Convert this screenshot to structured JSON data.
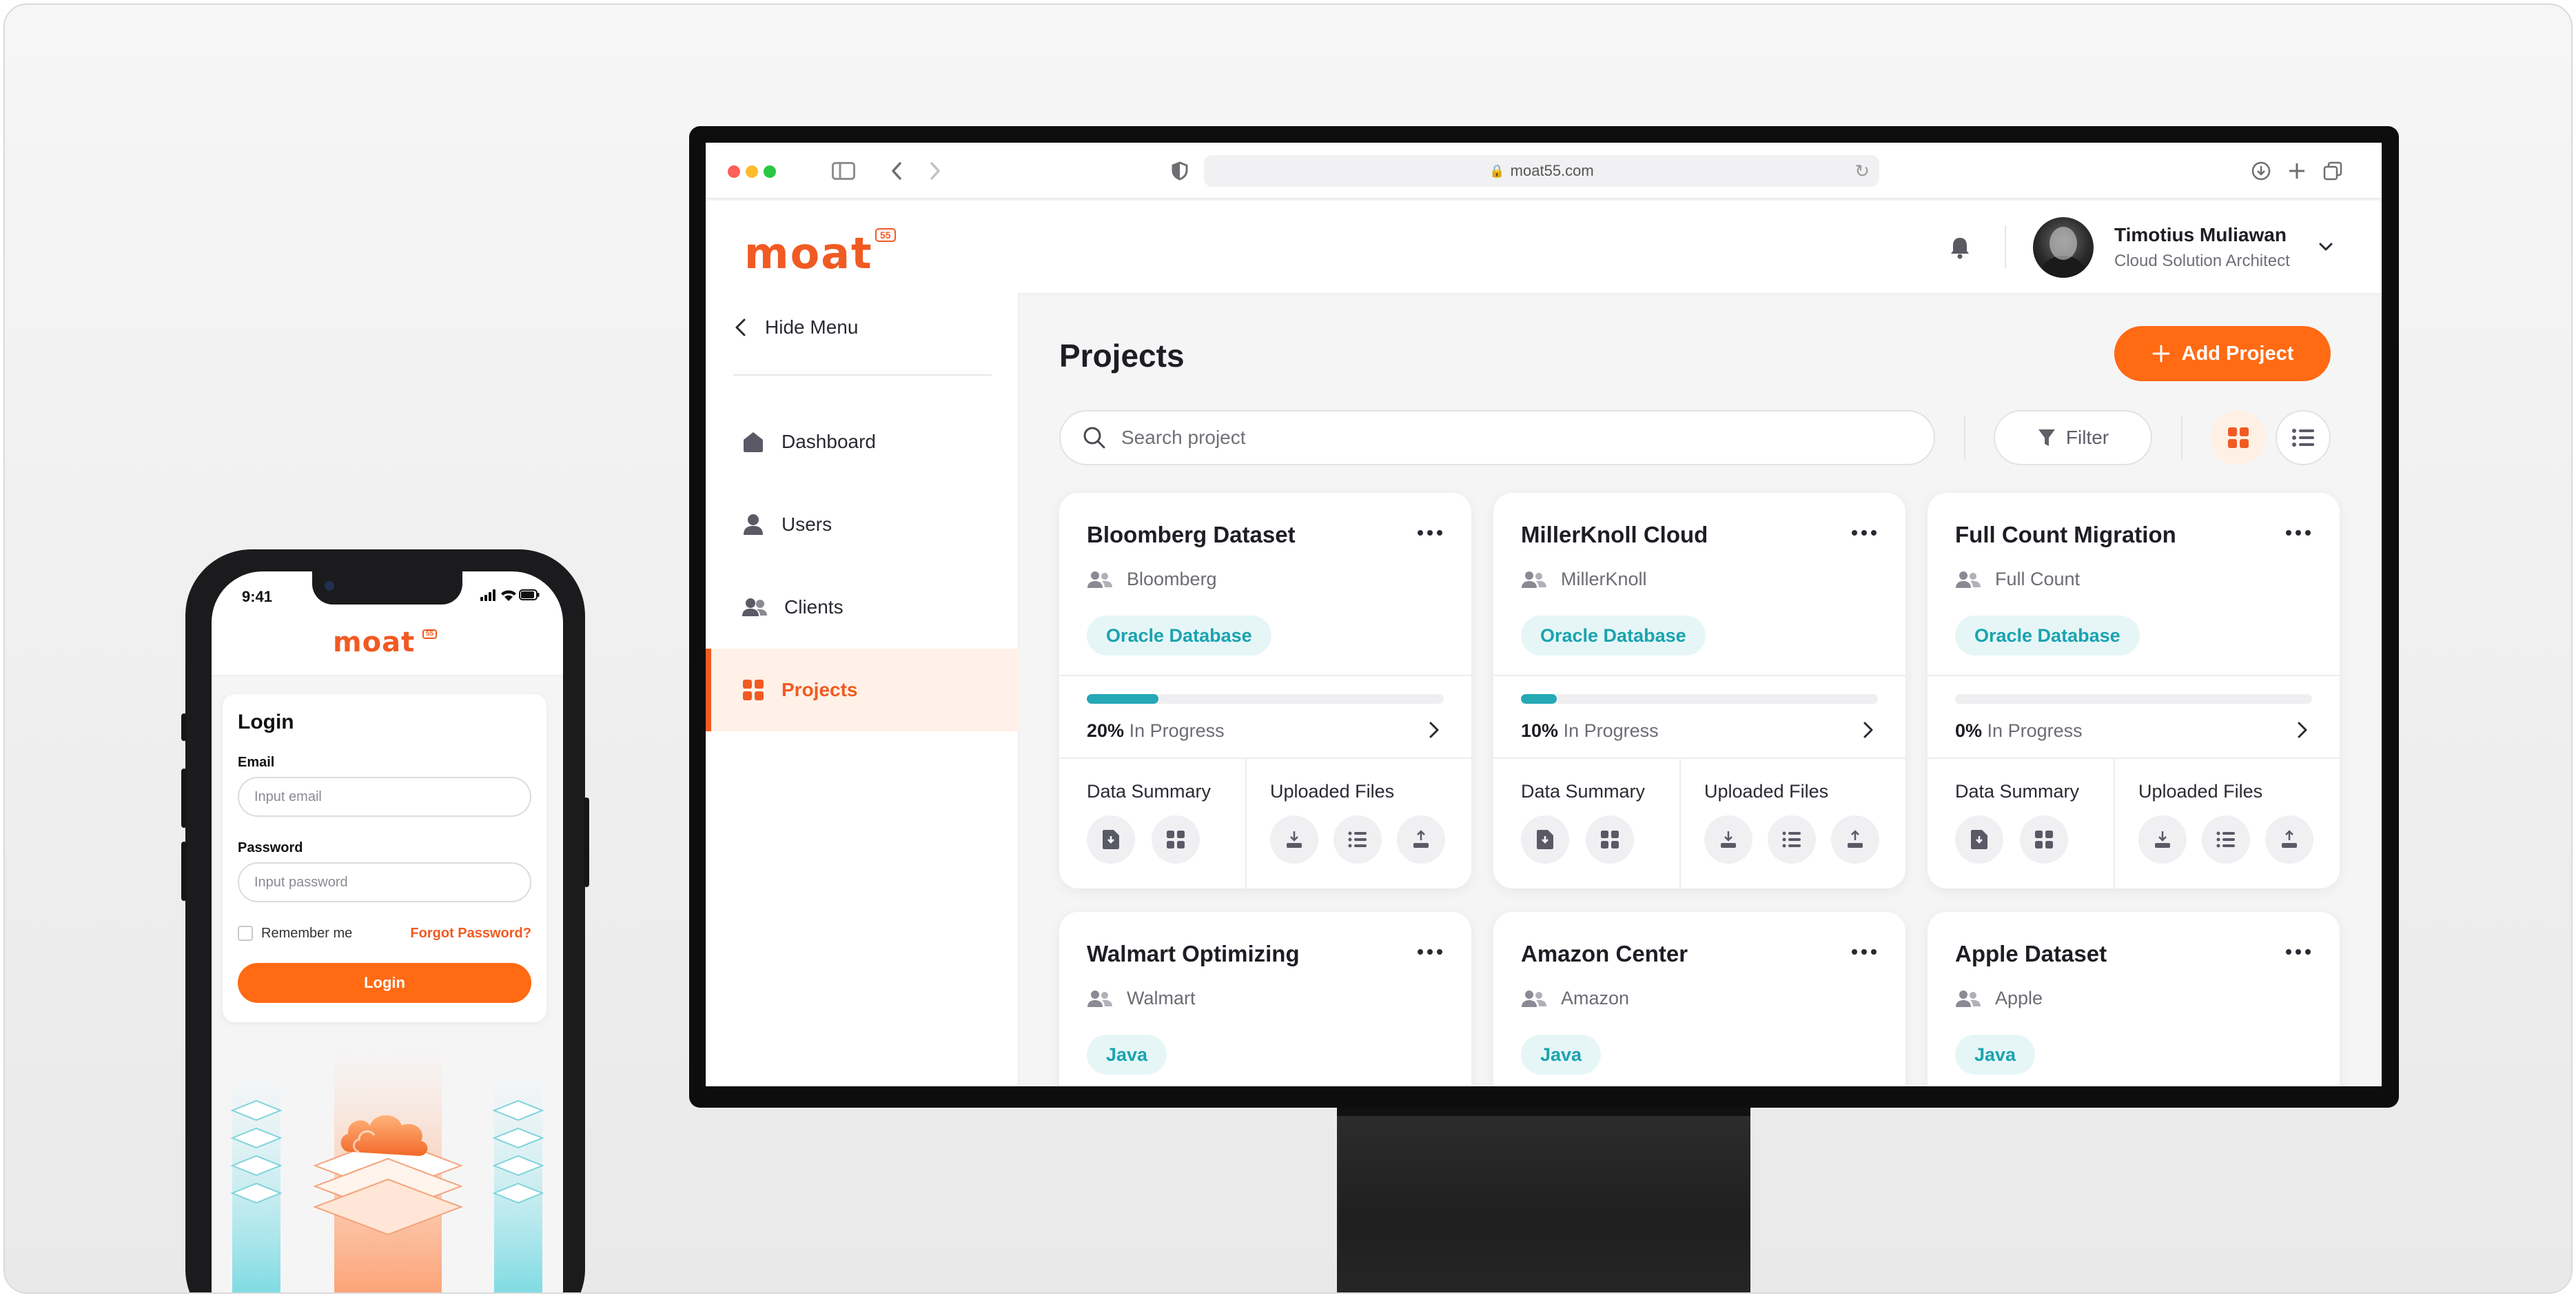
{
  "browser": {
    "url": "moat55.com"
  },
  "app": {
    "logo_text": "moat",
    "logo_badge": "55",
    "user": {
      "name": "Timotius Muliawan",
      "role": "Cloud Solution Architect"
    }
  },
  "sidebar": {
    "hide_label": "Hide Menu",
    "items": [
      {
        "label": "Dashboard",
        "icon": "home-icon"
      },
      {
        "label": "Users",
        "icon": "user-icon"
      },
      {
        "label": "Clients",
        "icon": "users-icon"
      },
      {
        "label": "Projects",
        "icon": "grid-icon",
        "active": true
      }
    ]
  },
  "main": {
    "title": "Projects",
    "add_button": "Add Project",
    "search_placeholder": "Search project",
    "filter_label": "Filter"
  },
  "labels": {
    "in_progress": "In Progress",
    "data_summary": "Data Summary",
    "uploaded_files": "Uploaded Files"
  },
  "projects": [
    {
      "title": "Bloomberg Dataset",
      "client": "Bloomberg",
      "tag": "Oracle Database",
      "progress_pct": 20,
      "progress_text": "20%"
    },
    {
      "title": "MillerKnoll Cloud",
      "client": "MillerKnoll",
      "tag": "Oracle Database",
      "progress_pct": 10,
      "progress_text": "10%"
    },
    {
      "title": "Full Count Migration",
      "client": "Full Count",
      "tag": "Oracle Database",
      "progress_pct": 0,
      "progress_text": "0%"
    },
    {
      "title": "Walmart Optimizing",
      "client": "Walmart",
      "tag": "Java"
    },
    {
      "title": "Amazon Center",
      "client": "Amazon",
      "tag": "Java"
    },
    {
      "title": "Apple Dataset",
      "client": "Apple",
      "tag": "Java"
    }
  ],
  "phone": {
    "time": "9:41",
    "logo_text": "moat",
    "logo_badge": "55",
    "login": {
      "title": "Login",
      "email_label": "Email",
      "email_placeholder": "Input email",
      "password_label": "Password",
      "password_placeholder": "Input password",
      "remember_label": "Remember me",
      "forgot_label": "Forgot Password?",
      "button_label": "Login"
    }
  },
  "colors": {
    "brand": "#f15a22",
    "accent_button": "#ff6a13",
    "progress": "#26a8b5",
    "tag_text": "#1aa3b0",
    "tag_bg": "#e6f6f7"
  }
}
